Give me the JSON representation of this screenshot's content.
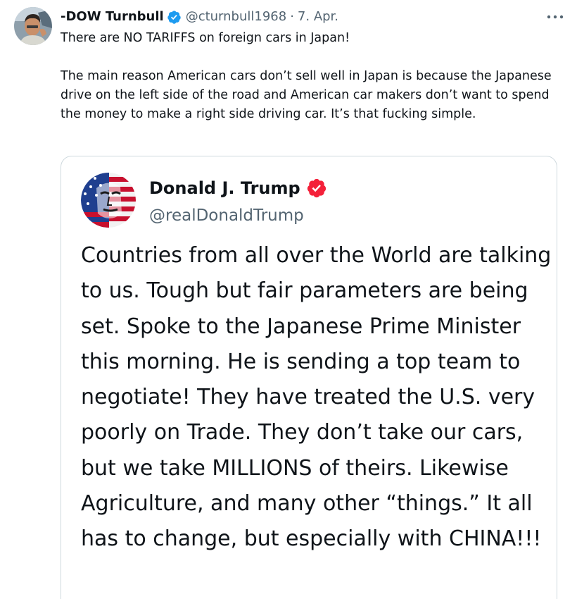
{
  "tweet": {
    "author": {
      "display_name": "-DOW Turnbull",
      "handle": "@cturnbull1968",
      "verified_color": "#1d9bf0"
    },
    "separator": "·",
    "date": "7. Apr.",
    "more_icon": "more-horizontal-icon",
    "paragraphs": [
      "There are NO TARIFFS on foreign cars in Japan!",
      "The main reason American cars don’t sell well in Japan is because the Japanese drive on the left side of the road and American car makers don’t want to spend the money to make a right side driving car. It’s that fucking simple."
    ]
  },
  "quoted_tweet": {
    "author": {
      "display_name": "Donald J. Trump",
      "handle": "@realDonaldTrump",
      "verified_color": "#f4213a"
    },
    "text": "Countries from all over the World are talking to us. Tough but fair parameters are being set. Spoke to the Japanese Prime Minister this morning. He is sending a top team to negotiate! They have treated the U.S. very poorly on Trade. They don’t take our cars, but we take MILLIONS of theirs. Likewise Agriculture, and many other “things.” It all has to change, but especially with CHINA!!!"
  },
  "colors": {
    "text_primary": "#0f1419",
    "text_secondary": "#536471",
    "border": "#cfd9de"
  }
}
